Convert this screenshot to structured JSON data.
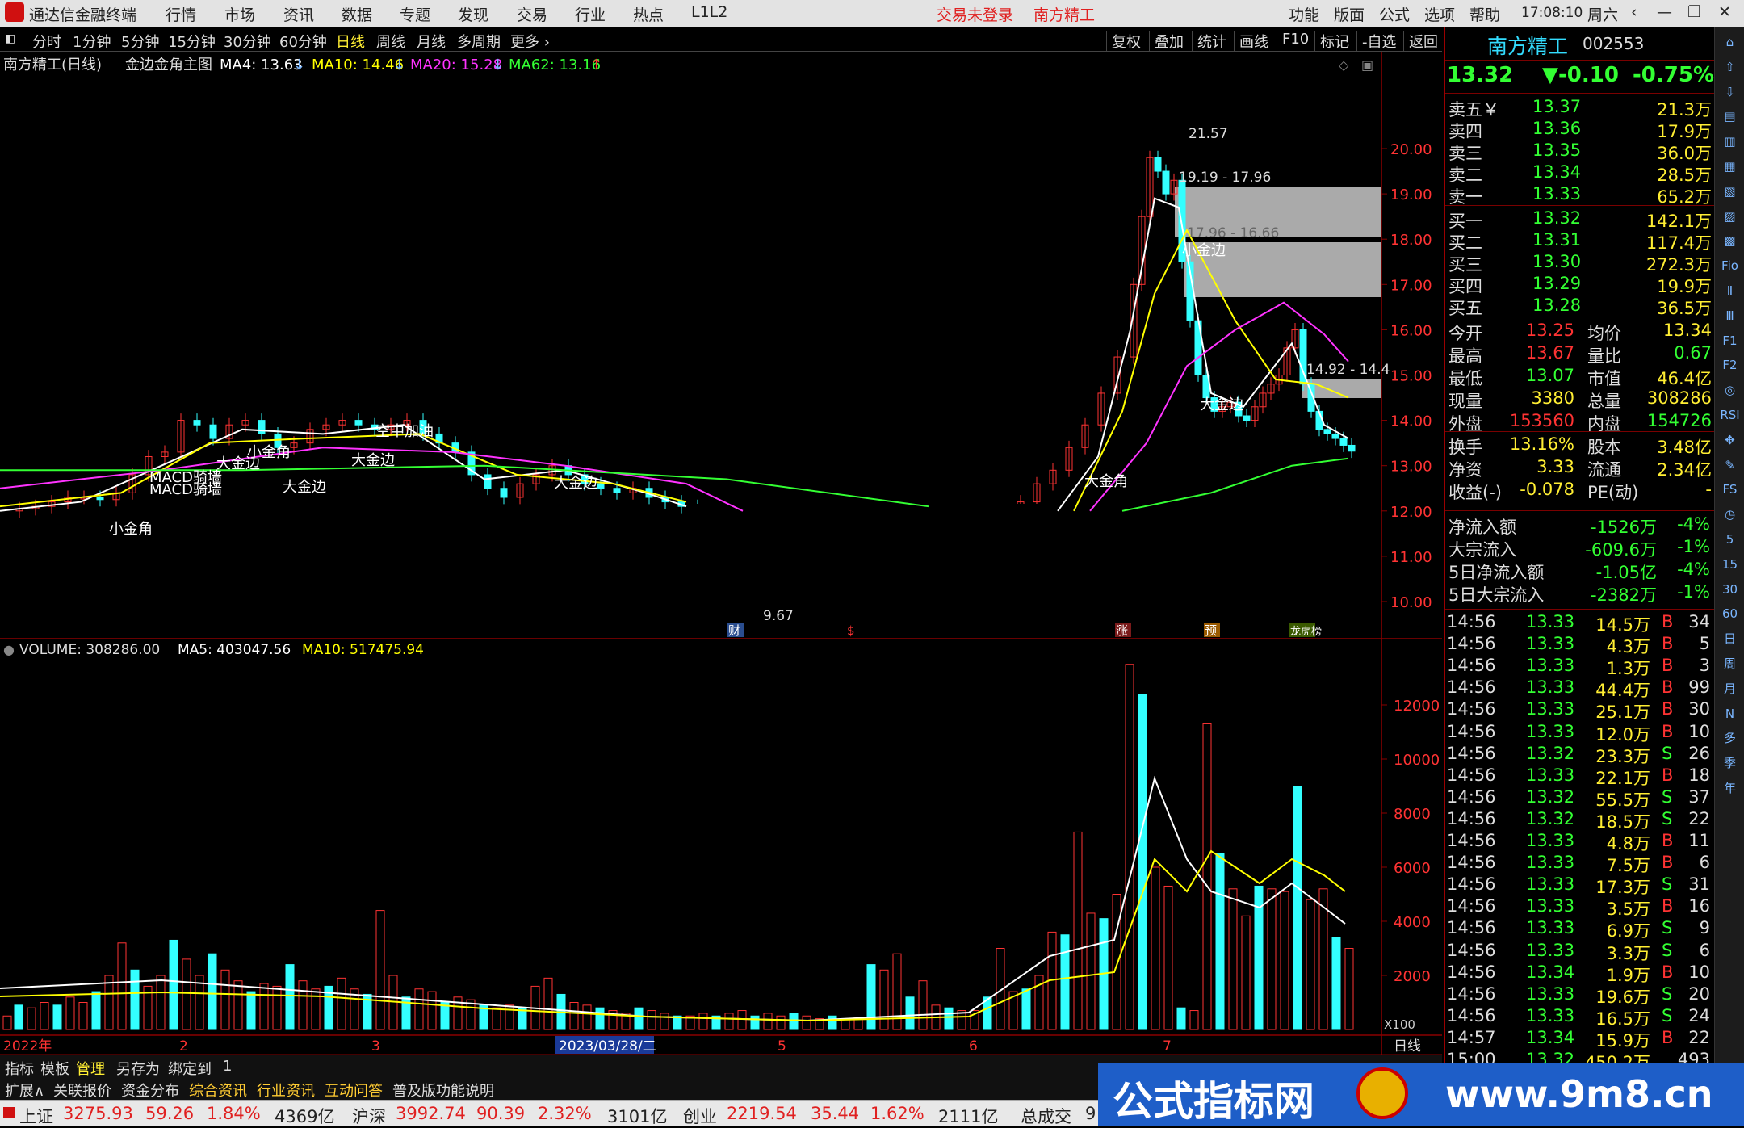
{
  "window": {
    "app_name": "通达信金融终端",
    "menus": [
      "行情",
      "市场",
      "资讯",
      "数据",
      "专题",
      "发现",
      "交易",
      "行业",
      "热点",
      "L1L2"
    ],
    "login_status": "交易未登录",
    "stock_title": "南方精工",
    "right_menus": [
      "功能",
      "版面",
      "公式",
      "选项",
      "帮助"
    ],
    "time": "17:08:10",
    "weekday": "周六"
  },
  "periods": {
    "items": [
      "分时",
      "1分钟",
      "5分钟",
      "15分钟",
      "30分钟",
      "60分钟",
      "日线",
      "周线",
      "月线",
      "多周期",
      "更多 ›"
    ],
    "active": "日线"
  },
  "tools": [
    "复权",
    "叠加",
    "统计",
    "画线",
    "F10",
    "标记",
    "-自选",
    "返回"
  ],
  "main_chart": {
    "title": "南方精工(日线)",
    "indicator": "金边金角主图",
    "ma": [
      {
        "label": "MA4: 13.63",
        "arrow": "↓",
        "color": "#ffffff"
      },
      {
        "label": "MA10: 14.46",
        "arrow": "↓",
        "color": "#ffff00"
      },
      {
        "label": "MA20: 15.28",
        "arrow": "↓",
        "color": "#ff33ff"
      },
      {
        "label": "MA62: 13.16",
        "arrow": "↑",
        "color": "#33ff33"
      }
    ],
    "y_ticks": [
      "20.00",
      "19.00",
      "18.00",
      "17.00",
      "16.00",
      "15.00",
      "14.00",
      "13.00",
      "12.00",
      "11.00",
      "10.00"
    ],
    "annotations": [
      "21.57",
      "19.19 - 17.96",
      "17.96 - 16.66",
      "14.92 - 14.4",
      "9.67",
      "小金边",
      "大金边",
      "大金角",
      "小金角",
      "MACD骑墙",
      "空中加油",
      "小金角",
      "大金边"
    ],
    "event_markers": [
      "财",
      "$",
      "涨",
      "预",
      "龙虎榜"
    ]
  },
  "volume_chart": {
    "title": "VOLUME: 308286.00",
    "ma5": "MA5: 403047.56",
    "ma10": "MA10: 517475.94",
    "y_ticks": [
      "12000",
      "10000",
      "8000",
      "6000",
      "4000",
      "2000"
    ],
    "unit": "X100"
  },
  "x_axis": {
    "labels": [
      "2022年",
      "2",
      "3",
      "2023/03/28/二",
      "5",
      "6",
      "7"
    ],
    "period": "日线"
  },
  "quote": {
    "name": "南方精工",
    "code": "002553",
    "price": "13.32",
    "change": "▼-0.10",
    "pct": "-0.75%",
    "asks": [
      {
        "label": "卖五￥",
        "price": "13.37",
        "vol": "21.3万"
      },
      {
        "label": "卖四",
        "price": "13.36",
        "vol": "17.9万"
      },
      {
        "label": "卖三",
        "price": "13.35",
        "vol": "36.0万"
      },
      {
        "label": "卖二",
        "price": "13.34",
        "vol": "28.5万"
      },
      {
        "label": "卖一",
        "price": "13.33",
        "vol": "65.2万"
      }
    ],
    "bids": [
      {
        "label": "买一",
        "price": "13.32",
        "vol": "142.1万"
      },
      {
        "label": "买二",
        "price": "13.31",
        "vol": "117.4万"
      },
      {
        "label": "买三",
        "price": "13.30",
        "vol": "272.3万"
      },
      {
        "label": "买四",
        "price": "13.29",
        "vol": "19.9万"
      },
      {
        "label": "买五",
        "price": "13.28",
        "vol": "36.5万"
      }
    ],
    "stats": [
      [
        "今开",
        "13.25",
        "均价",
        "13.34"
      ],
      [
        "最高",
        "13.67",
        "量比",
        "0.67"
      ],
      [
        "最低",
        "13.07",
        "市值",
        "46.4亿"
      ],
      [
        "现量",
        "3380",
        "总量",
        "308286"
      ],
      [
        "外盘",
        "153560",
        "内盘",
        "154726"
      ]
    ],
    "stats2": [
      [
        "换手",
        "13.16%",
        "股本",
        "3.48亿"
      ],
      [
        "净资",
        "3.33",
        "流通",
        "2.34亿"
      ],
      [
        "收益(-)",
        "-0.078",
        "PE(动)",
        "-"
      ]
    ],
    "flows": [
      [
        "净流入额",
        "-1526万",
        "-4%"
      ],
      [
        "大宗流入",
        "-609.6万",
        "-1%"
      ],
      [
        "5日净流入额",
        "-1.05亿",
        "-4%"
      ],
      [
        "5日大宗流入",
        "-2382万",
        "-1%"
      ]
    ],
    "ticks": [
      [
        "14:56",
        "13.33",
        "14.5万",
        "B",
        "34"
      ],
      [
        "14:56",
        "13.33",
        "4.3万",
        "B",
        "5"
      ],
      [
        "14:56",
        "13.33",
        "1.3万",
        "B",
        "3"
      ],
      [
        "14:56",
        "13.33",
        "44.4万",
        "B",
        "99"
      ],
      [
        "14:56",
        "13.33",
        "25.1万",
        "B",
        "30"
      ],
      [
        "14:56",
        "13.33",
        "12.0万",
        "B",
        "10"
      ],
      [
        "14:56",
        "13.32",
        "23.3万",
        "S",
        "26"
      ],
      [
        "14:56",
        "13.33",
        "22.1万",
        "B",
        "18"
      ],
      [
        "14:56",
        "13.32",
        "55.5万",
        "S",
        "37"
      ],
      [
        "14:56",
        "13.32",
        "18.5万",
        "S",
        "22"
      ],
      [
        "14:56",
        "13.33",
        "4.8万",
        "B",
        "11"
      ],
      [
        "14:56",
        "13.33",
        "7.5万",
        "B",
        "6"
      ],
      [
        "14:56",
        "13.33",
        "17.3万",
        "S",
        "31"
      ],
      [
        "14:56",
        "13.33",
        "3.5万",
        "B",
        "16"
      ],
      [
        "14:56",
        "13.33",
        "6.9万",
        "S",
        "9"
      ],
      [
        "14:56",
        "13.33",
        "3.3万",
        "S",
        "6"
      ],
      [
        "14:56",
        "13.34",
        "1.9万",
        "B",
        "10"
      ],
      [
        "14:56",
        "13.33",
        "19.6万",
        "S",
        "20"
      ],
      [
        "14:56",
        "13.33",
        "16.5万",
        "S",
        "24"
      ],
      [
        "14:57",
        "13.34",
        "15.9万",
        "B",
        "22"
      ],
      [
        "15:00",
        "13.32",
        "450.2万",
        "",
        "493"
      ]
    ]
  },
  "sidebar": [
    "⌂",
    "⇧",
    "⇩",
    "▤",
    "▥",
    "▦",
    "▧",
    "▨",
    "▩",
    "Fio",
    "Ⅱ",
    "Ⅲ",
    "F1",
    "F2",
    "◎",
    "RSI",
    "✥",
    "✎",
    "FS",
    "◷",
    "5",
    "15",
    "30",
    "60",
    "日",
    "周",
    "月",
    "N",
    "多",
    "季",
    "年"
  ],
  "bottom_tabs": [
    "指标",
    "模板",
    "管理",
    "另存为",
    "绑定到",
    "1"
  ],
  "bottom_tabs_active": "管理",
  "info_tabs": [
    "扩展∧",
    "关联报价",
    "资金分布",
    "综合资讯",
    "行业资讯",
    "互动问答",
    "普及版功能说明"
  ],
  "status": {
    "sh_label": "上证",
    "sh_val": "3275.93",
    "sh_chg": "59.26",
    "sh_pct": "1.84%",
    "sh_amt": "4369亿",
    "hs_label": "沪深",
    "hs_val": "3992.74",
    "hs_chg": "90.39",
    "hs_pct": "2.32%",
    "hs_amt": "3101亿",
    "cy_label": "创业",
    "cy_val": "2219.54",
    "cy_chg": "35.44",
    "cy_pct": "1.62%",
    "cy_amt": "2111亿",
    "total_label": "总成交",
    "total_val": "9"
  },
  "watermark": {
    "left": "公式指标网",
    "right": "www.9m8.cn"
  }
}
